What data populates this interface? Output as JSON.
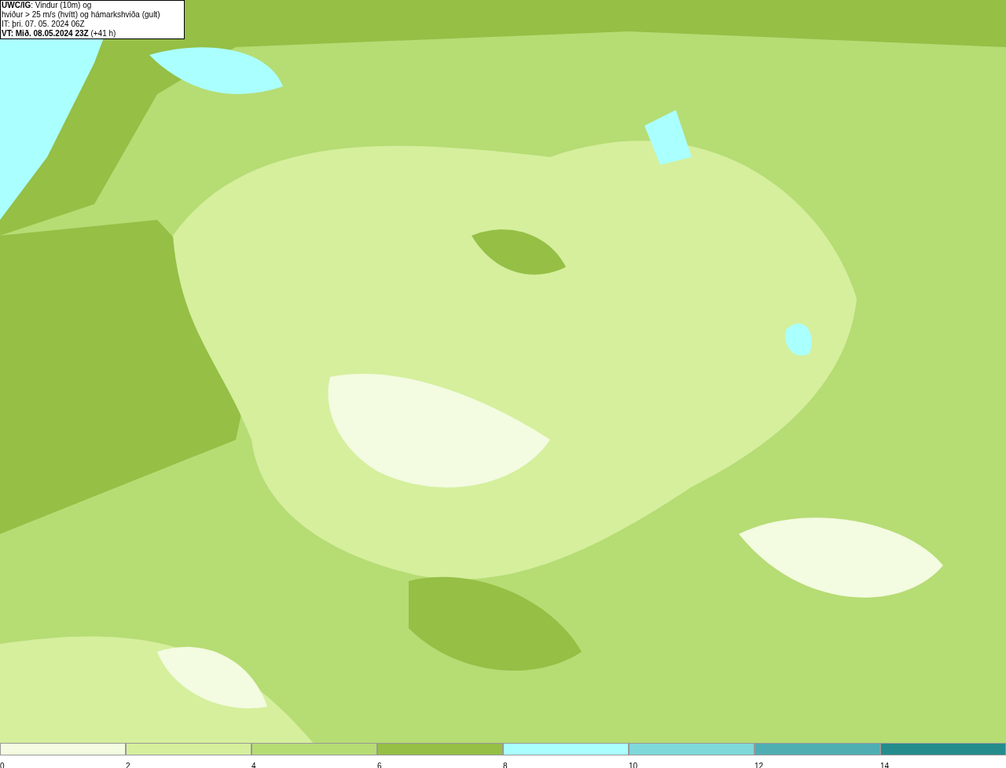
{
  "legend": {
    "lines": [
      "**UWC/IG**: Vindur (10m) og",
      "hviður > 25 m/s (hvítt) og hámarkshviða (gult)",
      "IT: þri. 07. 05. 2024 06Z",
      "**VT: Mið. 08.05.2024 23Z** (+41 h)"
    ]
  },
  "colorbar": {
    "bins": [
      {
        "label": "0",
        "color": "#f3fbe0"
      },
      {
        "label": "2",
        "color": "#d5ef9d"
      },
      {
        "label": "4",
        "color": "#b6dc74"
      },
      {
        "label": "6",
        "color": "#95bf45"
      },
      {
        "label": "8",
        "color": "#aaffff"
      },
      {
        "label": "10",
        "color": "#7fd8da"
      },
      {
        "label": "12",
        "color": "#4faeb2"
      },
      {
        "label": "14",
        "color": "#248c8c"
      }
    ]
  }
}
